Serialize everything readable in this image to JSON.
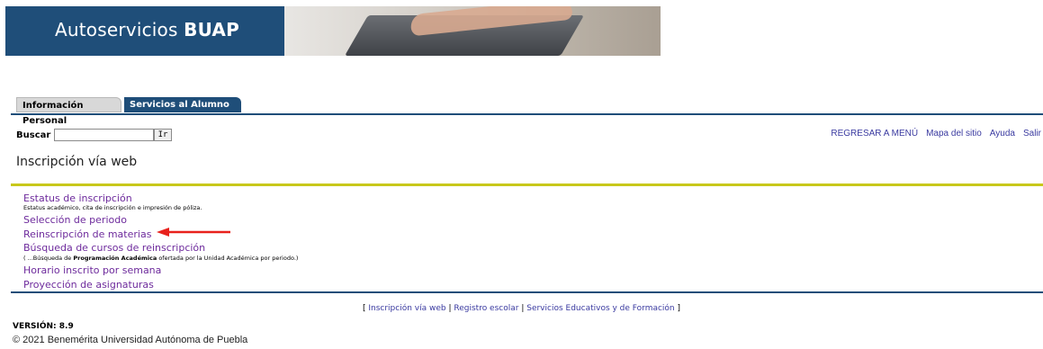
{
  "banner": {
    "brand_light": "Autoservicios ",
    "brand_bold": "BUAP"
  },
  "tabs": [
    {
      "label": "Información Personal",
      "active": false
    },
    {
      "label": "Servicios al Alumno",
      "active": true
    }
  ],
  "search": {
    "label": "Buscar",
    "value": "",
    "placeholder": "",
    "go_label": "Ir"
  },
  "toplinks": [
    "REGRESAR A MENÚ",
    "Mapa del sitio",
    "Ayuda",
    "Salir"
  ],
  "page_title": "Inscripción vía web",
  "menu": {
    "item1": "Estatus de inscripción",
    "item1_desc": "Estatus académico, cita de inscripción e impresión de póliza.",
    "item2": "Selección de periodo",
    "item3": "Reinscripción de materias",
    "item4": "Búsqueda de cursos de reinscripción",
    "item4_desc_pre": "( ...Búsqueda de ",
    "item4_desc_bold": "Programación Académica",
    "item4_desc_post": " ofertada por la Unidad Académica por periodo.)",
    "item5": "Horario inscrito por semana",
    "item6": "Proyección de asignaturas"
  },
  "footer": {
    "open": "[ ",
    "link1": "Inscripción vía web",
    "sep1": " | ",
    "link2": "Registro escolar",
    "sep2": " | ",
    "link3": "Servicios Educativos y de Formación",
    "close": " ]"
  },
  "version": "VERSIÓN: 8.9",
  "copyright": "© 2021 Benemérita Universidad Autónoma de Puebla",
  "colors": {
    "navy": "#1f4e79",
    "link_purple": "#6d2a9c",
    "accent_yellow": "#c8c81a",
    "arrow_red": "#e8211c"
  }
}
